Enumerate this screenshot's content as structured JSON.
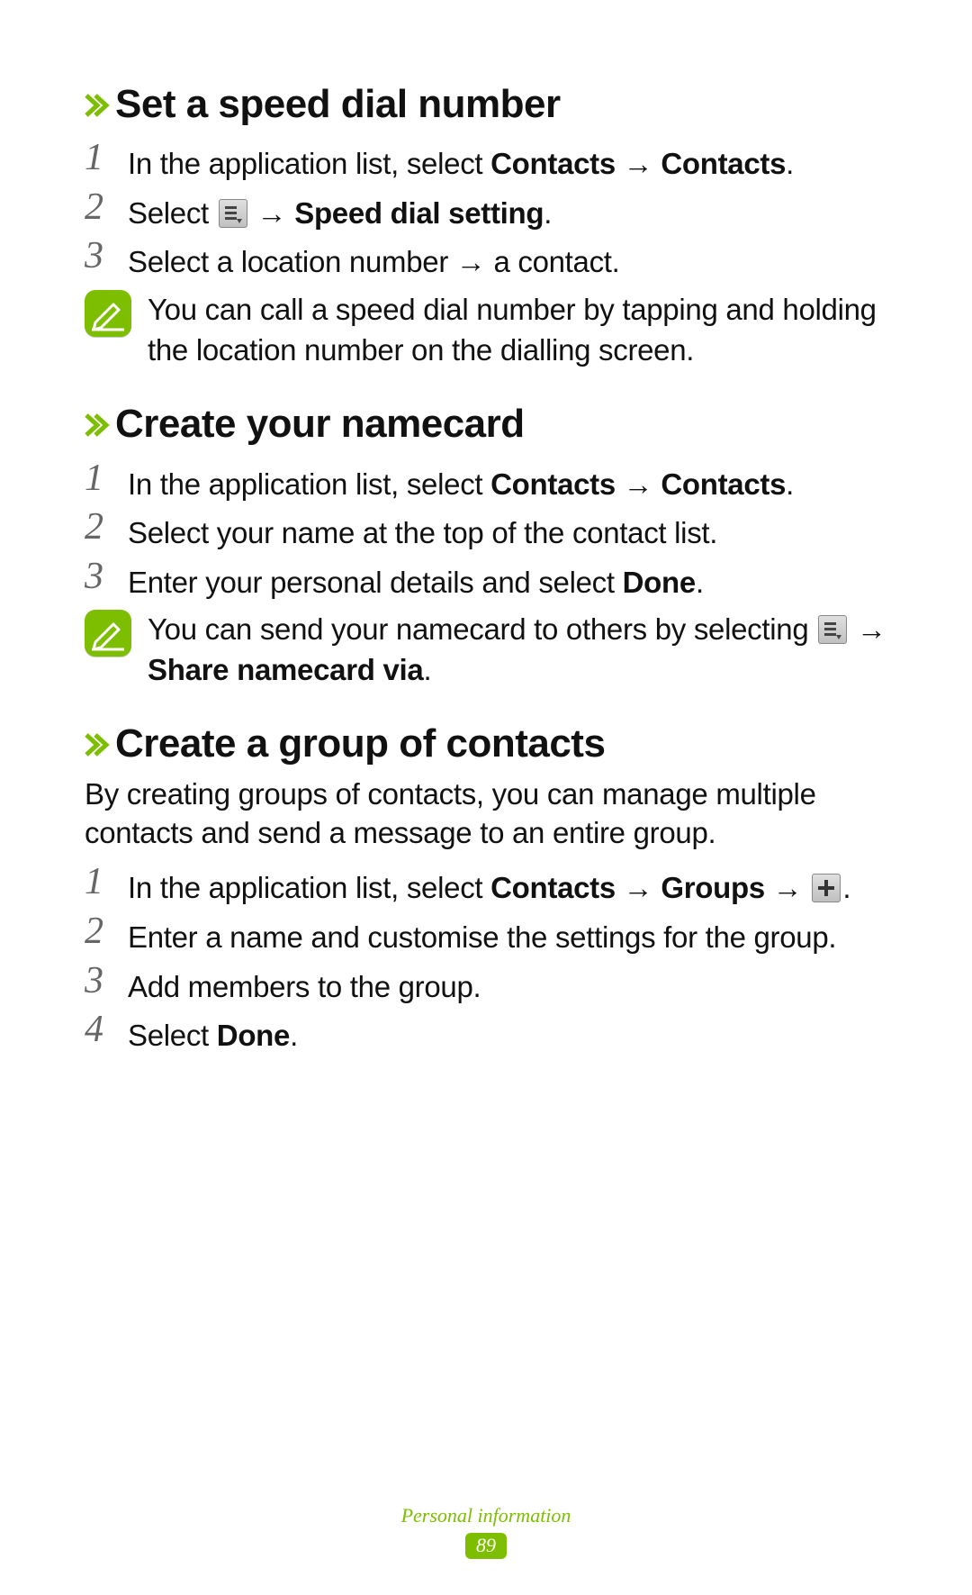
{
  "sections": {
    "s1": {
      "title": "Set a speed dial number",
      "steps": {
        "n1": "1",
        "t1_a": "In the application list, select ",
        "t1_b1": "Contacts",
        "t1_arrow1": " → ",
        "t1_b2": "Contacts",
        "t1_c": ".",
        "n2": "2",
        "t2_a": "Select ",
        "t2_arrow": " → ",
        "t2_b": "Speed dial setting",
        "t2_c": ".",
        "n3": "3",
        "t3": "Select a location number → a contact."
      },
      "note": "You can call a speed dial number by tapping and holding the location number on the dialling screen."
    },
    "s2": {
      "title": "Create your namecard",
      "steps": {
        "n1": "1",
        "t1_a": "In the application list, select ",
        "t1_b1": "Contacts",
        "t1_arrow1": " → ",
        "t1_b2": "Contacts",
        "t1_c": ".",
        "n2": "2",
        "t2": "Select your name at the top of the contact list.",
        "n3": "3",
        "t3_a": "Enter your personal details and select ",
        "t3_b": "Done",
        "t3_c": "."
      },
      "note_a": "You can send your namecard to others by selecting ",
      "note_arrow": " → ",
      "note_b": "Share namecard via",
      "note_c": "."
    },
    "s3": {
      "title": "Create a group of contacts",
      "intro": "By creating groups of contacts, you can manage multiple contacts and send a message to an entire group.",
      "steps": {
        "n1": "1",
        "t1_a": "In the application list, select ",
        "t1_b1": "Contacts",
        "t1_arrow1": " → ",
        "t1_b2": "Groups",
        "t1_arrow2": " → ",
        "t1_c": ".",
        "n2": "2",
        "t2": "Enter a name and customise the settings for the group.",
        "n3": "3",
        "t3": "Add members to the group.",
        "n4": "4",
        "t4_a": "Select ",
        "t4_b": "Done",
        "t4_c": "."
      }
    }
  },
  "footer": {
    "chapter": "Personal information",
    "page": "89"
  }
}
